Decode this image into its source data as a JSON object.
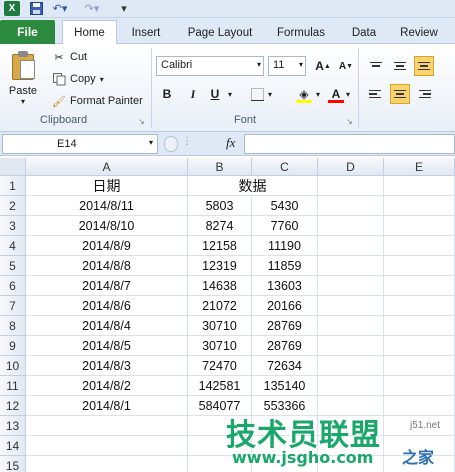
{
  "tabs": {
    "file": "File",
    "home": "Home",
    "insert": "Insert",
    "page_layout": "Page Layout",
    "formulas": "Formulas",
    "data": "Data",
    "review": "Review"
  },
  "ribbon": {
    "paste": "Paste",
    "cut": "Cut",
    "copy": "Copy",
    "format_painter": "Format Painter",
    "clipboard_label": "Clipboard",
    "font_label": "Font",
    "font_name": "Calibri",
    "font_size": "11",
    "bold": "B",
    "italic": "I",
    "underline": "U",
    "font_color_letter": "A",
    "fill_color": "#ffff00",
    "font_color": "#ff0000"
  },
  "formula_bar": {
    "name_box": "E14",
    "fx": "fx"
  },
  "grid": {
    "columns": [
      "A",
      "B",
      "C",
      "D",
      "E"
    ],
    "rows": [
      "1",
      "2",
      "3",
      "4",
      "5",
      "6",
      "7",
      "8",
      "9",
      "10",
      "11",
      "12",
      "13",
      "14",
      "15"
    ],
    "header_a": "日期",
    "header_bc": "数据",
    "data": [
      [
        "2014/8/11",
        "5803",
        "5430"
      ],
      [
        "2014/8/10",
        "8274",
        "7760"
      ],
      [
        "2014/8/9",
        "12158",
        "11190"
      ],
      [
        "2014/8/8",
        "12319",
        "11859"
      ],
      [
        "2014/8/7",
        "14638",
        "13603"
      ],
      [
        "2014/8/6",
        "21072",
        "20166"
      ],
      [
        "2014/8/4",
        "30710",
        "28769"
      ],
      [
        "2014/8/5",
        "30710",
        "28769"
      ],
      [
        "2014/8/3",
        "72470",
        "72634"
      ],
      [
        "2014/8/2",
        "142581",
        "135140"
      ],
      [
        "2014/8/1",
        "584077",
        "553366"
      ]
    ]
  },
  "watermark": {
    "logo": "技术员联盟",
    "url": "www.jsgho.com",
    "side_text": "j51.net",
    "side_text2": "之家"
  }
}
